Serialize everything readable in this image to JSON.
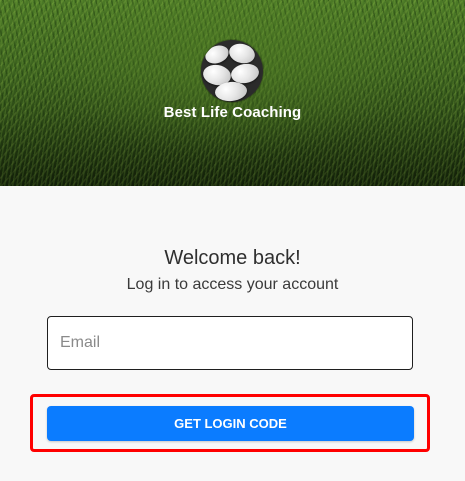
{
  "header": {
    "brand_name": "Best Life Coaching",
    "logo_icon": "stones-logo-icon"
  },
  "login": {
    "welcome": "Welcome back!",
    "subtitle": "Log in to access your account",
    "email_placeholder": "Email",
    "email_value": "",
    "button_label": "GET LOGIN CODE"
  },
  "colors": {
    "accent": "#0b7cff",
    "highlight": "#ff0000",
    "background": "#f8f8f8"
  }
}
